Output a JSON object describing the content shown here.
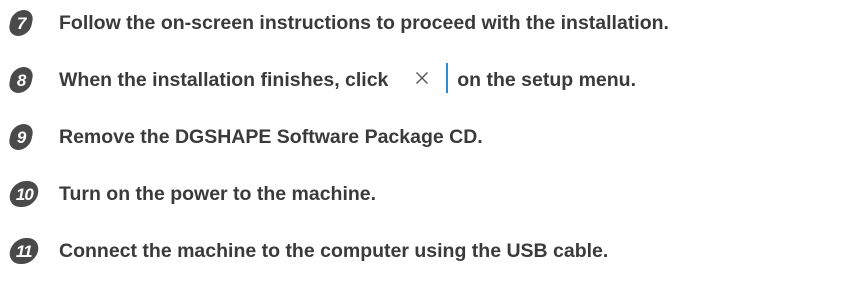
{
  "steps": [
    {
      "number": "7",
      "text": "Follow the on-screen instructions to proceed with the installation."
    },
    {
      "number": "8",
      "text_before": "When the installation finishes, click",
      "text_after": "on the setup menu.",
      "inline_icon": "close-icon"
    },
    {
      "number": "9",
      "text": "Remove the DGSHAPE Software Package CD."
    },
    {
      "number": "10",
      "text": "Turn on the power to the machine."
    },
    {
      "number": "11",
      "text": "Connect the machine to the computer using the USB cable."
    }
  ],
  "colors": {
    "badge": "#4a4a4a",
    "text": "#3a3a3a",
    "close_button_accent": "#2a8bd8"
  }
}
